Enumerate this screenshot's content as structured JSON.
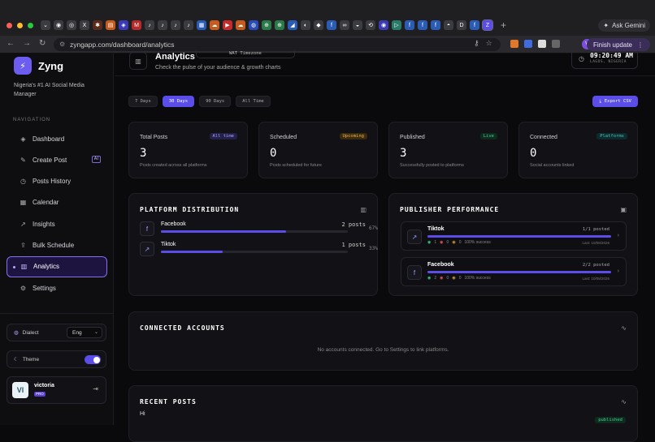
{
  "browser": {
    "url": "zyngapp.com/dashboard/analytics",
    "ask_gemini": "Ask Gemini",
    "finish_update": "Finish update",
    "profile_initial": "V",
    "new_tab": "+"
  },
  "sidebar": {
    "brand": "Zyng",
    "tagline": "Nigeria's #1 AI Social Media Manager",
    "nav_label": "NAVIGATION",
    "items": [
      {
        "label": "Dashboard",
        "icon": "grid-icon"
      },
      {
        "label": "Create Post",
        "icon": "edit-icon",
        "badge": "AI"
      },
      {
        "label": "Posts History",
        "icon": "history-icon"
      },
      {
        "label": "Calendar",
        "icon": "calendar-icon"
      },
      {
        "label": "Insights",
        "icon": "trend-icon"
      },
      {
        "label": "Bulk Schedule",
        "icon": "upload-icon"
      },
      {
        "label": "Analytics",
        "icon": "bar-chart-icon",
        "active": true
      },
      {
        "label": "Settings",
        "icon": "gear-icon"
      }
    ],
    "dialect_label": "Dialect",
    "dialect_value": "Eng",
    "theme_label": "Theme",
    "theme_on": true,
    "user": {
      "initials": "VI",
      "name": "victoria",
      "plan": "PRO"
    }
  },
  "header": {
    "title": "Analytics",
    "timezone": "WAT Timezone",
    "subtitle": "Check the pulse of your audience & growth charts",
    "time": "09:20:49 AM",
    "location": "LAGOS, NIGERIA"
  },
  "ranges": [
    "7 Days",
    "30 Days",
    "90 Days",
    "All Time"
  ],
  "active_range": "30 Days",
  "export_label": "Export CSV",
  "stats": [
    {
      "label": "Total Posts",
      "badge": "All time",
      "value": "3",
      "desc": "Posts created across all platforms",
      "badge_bg": "#23214a",
      "badge_fg": "#a9a2ff"
    },
    {
      "label": "Scheduled",
      "badge": "Upcoming",
      "value": "0",
      "desc": "Posts scheduled for future",
      "badge_bg": "#3a2a0e",
      "badge_fg": "#f0b34a"
    },
    {
      "label": "Published",
      "badge": "Live",
      "value": "3",
      "desc": "Successfully posted to platforms",
      "badge_bg": "#0f2a1f",
      "badge_fg": "#3fcf8e"
    },
    {
      "label": "Connected",
      "badge": "Platforms",
      "value": "0",
      "desc": "Social accounts linked",
      "badge_bg": "#0f2a2a",
      "badge_fg": "#3fc8c8"
    }
  ],
  "platform_distribution": {
    "title": "PLATFORM DISTRIBUTION",
    "rows": [
      {
        "name": "Facebook",
        "count": "2 posts",
        "pct": "67%",
        "fraction": 0.67,
        "icon": "facebook-icon"
      },
      {
        "name": "Tiktok",
        "count": "1 posts",
        "pct": "33%",
        "fraction": 0.33,
        "icon": "trend-icon"
      }
    ]
  },
  "publisher_performance": {
    "title": "PUBLISHER PERFORMANCE",
    "rows": [
      {
        "name": "Tiktok",
        "posted": "1/1 posted",
        "ok": "1",
        "fail": "0",
        "pending": "0",
        "success": "100% success",
        "last": "Last: 10/08/2026",
        "icon": "trend-icon"
      },
      {
        "name": "Facebook",
        "posted": "2/2 posted",
        "ok": "2",
        "fail": "0",
        "pending": "0",
        "success": "100% success",
        "last": "Last: 10/08/2026",
        "icon": "facebook-icon"
      }
    ]
  },
  "connected_accounts": {
    "title": "CONNECTED ACCOUNTS",
    "empty": "No accounts connected. Go to Settings to link platforms."
  },
  "recent_posts": {
    "title": "RECENT POSTS",
    "first_text": "Hi",
    "first_status": "published"
  }
}
